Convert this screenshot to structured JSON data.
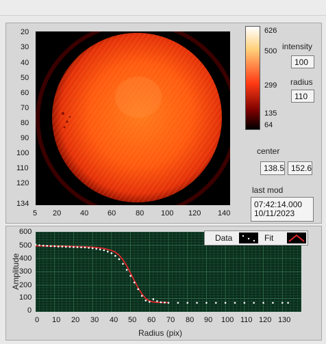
{
  "image_plot": {
    "x_ticks": [
      "5",
      "20",
      "40",
      "60",
      "80",
      "100",
      "120",
      "140"
    ],
    "y_ticks": [
      "20",
      "30",
      "40",
      "50",
      "60",
      "70",
      "80",
      "90",
      "100",
      "110",
      "120",
      "134"
    ]
  },
  "colorbar": {
    "labels": [
      "626",
      "500",
      "299",
      "135",
      "64"
    ],
    "colors": [
      "#ffffff",
      "#ffd07a",
      "#ff3b14",
      "#7a0000",
      "#000000"
    ]
  },
  "controls": {
    "intensity_label": "intensity",
    "intensity_value": "100",
    "radius_label": "radius",
    "radius_value": "110",
    "center_label": "center",
    "center_x": "138.5",
    "center_y": "152.6",
    "last_mod_label": "last mod",
    "last_mod_time": "07:42:14.000",
    "last_mod_date": "10/11/2023"
  },
  "profile_chart": {
    "ylabel": "Amplitude",
    "xlabel": "Radius (pix)",
    "legend_data": "Data",
    "legend_fit": "Fit",
    "x_ticks": [
      "0",
      "10",
      "20",
      "30",
      "40",
      "50",
      "60",
      "70",
      "80",
      "90",
      "100",
      "110",
      "120",
      "130"
    ],
    "y_ticks": [
      "600",
      "500",
      "400",
      "300",
      "200",
      "100",
      "0"
    ],
    "background_color": "#0a2d1c",
    "grid_color": "#2e6b4a",
    "fit_color": "#e0262a",
    "data_color": "#ffffff"
  },
  "chart_data": {
    "type": "line",
    "x_range": [
      0,
      140
    ],
    "y_range": [
      0,
      600
    ],
    "series": [
      {
        "name": "Data",
        "x": [
          0,
          2,
          4,
          6,
          8,
          10,
          12,
          14,
          16,
          18,
          20,
          22,
          24,
          26,
          28,
          30,
          32,
          34,
          36,
          38,
          40,
          42,
          44,
          46,
          48,
          50,
          52,
          54,
          56,
          58,
          60,
          62,
          64,
          66,
          68,
          70,
          75,
          80,
          85,
          90,
          95,
          100,
          105,
          110,
          115,
          120,
          125,
          130,
          133
        ],
        "y": [
          505,
          500,
          497,
          495,
          493,
          492,
          490,
          490,
          488,
          487,
          486,
          485,
          484,
          483,
          480,
          477,
          473,
          468,
          462,
          452,
          440,
          420,
          395,
          360,
          315,
          270,
          220,
          170,
          120,
          85,
          75,
          95,
          80,
          72,
          70,
          68,
          68,
          68,
          68,
          68,
          68,
          68,
          68,
          68,
          68,
          68,
          68,
          68,
          68
        ]
      },
      {
        "name": "Fit",
        "x": [
          0,
          5,
          10,
          15,
          20,
          25,
          30,
          35,
          40,
          42,
          44,
          46,
          48,
          50,
          52,
          54,
          56,
          58,
          60,
          62,
          64,
          66,
          68,
          70
        ],
        "y": [
          495,
          494,
          493,
          492,
          490,
          488,
          485,
          478,
          460,
          448,
          425,
          390,
          345,
          290,
          235,
          180,
          135,
          100,
          82,
          74,
          71,
          70,
          70,
          70
        ]
      }
    ]
  }
}
